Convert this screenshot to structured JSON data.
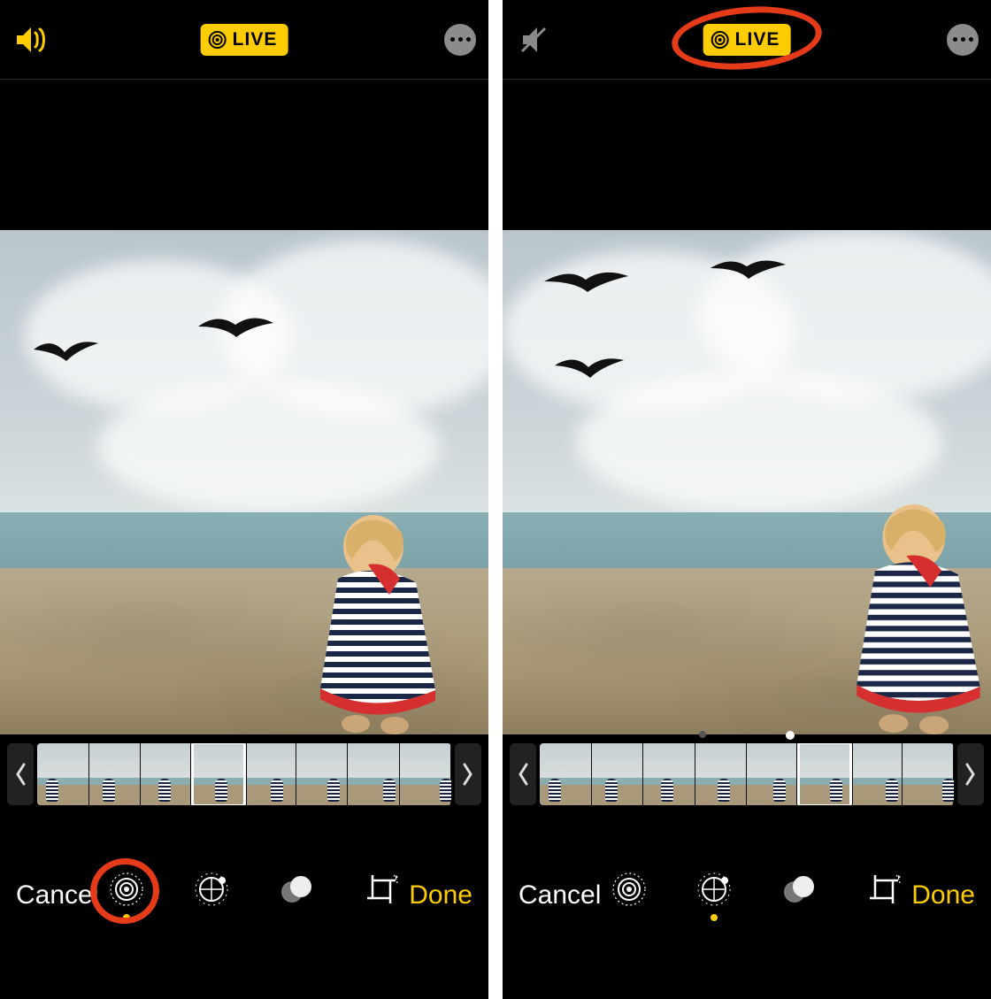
{
  "colors": {
    "accent": "#ffcc00",
    "highlight": "#e63b19"
  },
  "left": {
    "header": {
      "sound": "on",
      "live_label": "LIVE"
    },
    "strip": {
      "frames": 8,
      "selected_index": 3
    },
    "toolbar": {
      "cancel_label": "Cancel",
      "done_label": "Done",
      "tools": [
        "live-photo",
        "adjust",
        "filters",
        "crop"
      ],
      "active_tool_index": 0
    },
    "highlight": "live-tool"
  },
  "right": {
    "header": {
      "sound": "muted",
      "live_label": "LIVE"
    },
    "strip": {
      "frames": 8,
      "selected_index": 5,
      "show_dots": true
    },
    "toolbar": {
      "cancel_label": "Cancel",
      "done_label": "Done",
      "tools": [
        "live-photo",
        "adjust",
        "filters",
        "crop"
      ],
      "active_tool_index": 1
    },
    "highlight": "live-pill"
  }
}
